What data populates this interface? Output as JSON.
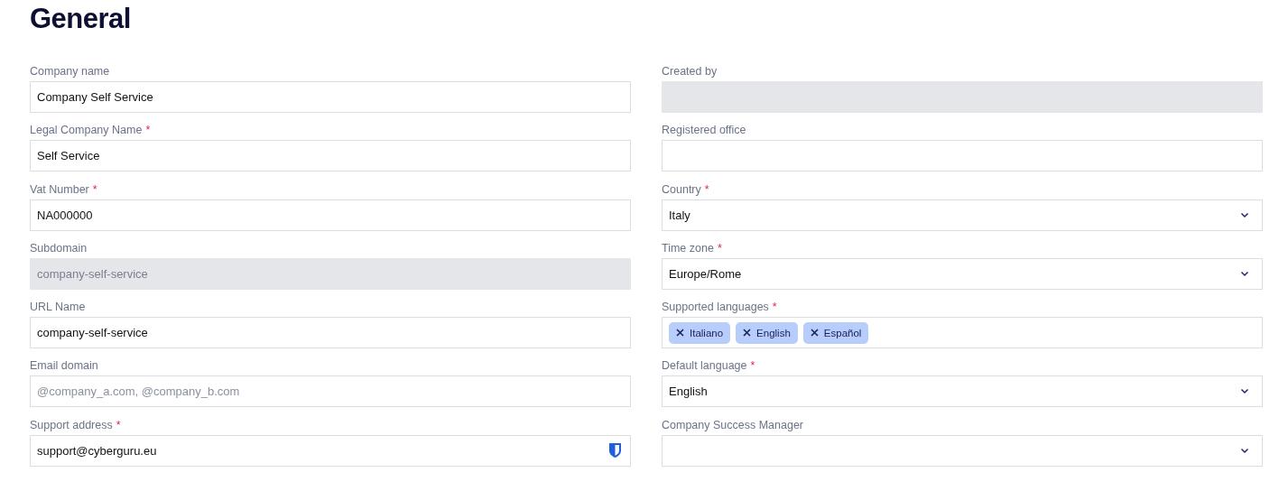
{
  "title": "General",
  "columns": [
    [
      {
        "label": "Company name",
        "kind": "text",
        "value": "Company Self Service"
      },
      {
        "label": "Legal Company Name",
        "asterisk": "*",
        "kind": "text",
        "value": "Self Service"
      },
      {
        "label": "Vat Number",
        "asterisk": "*",
        "kind": "text",
        "value": "NA000000"
      },
      {
        "label": "Subdomain",
        "kind": "text",
        "disabled": true,
        "value": "company-self-service"
      },
      {
        "label": "URL Name",
        "kind": "text",
        "value": "company-self-service"
      },
      {
        "label": "Email domain",
        "kind": "text",
        "placeholder": "@company_a.com, @company_b.com"
      },
      {
        "label": "Support address",
        "asterisk": "*",
        "kind": "text",
        "value": "support@cyberguru.eu",
        "shield": true
      }
    ],
    [
      {
        "label": "Created by",
        "kind": "text",
        "disabled": true
      },
      {
        "label": "Registered office",
        "kind": "text"
      },
      {
        "label": "Country",
        "asterisk": "*",
        "kind": "select",
        "value": "Italy"
      },
      {
        "label": "Time zone",
        "asterisk": "*",
        "kind": "select",
        "value": "Europe/Rome"
      },
      {
        "label": "Supported languages",
        "asterisk": "*",
        "kind": "tags",
        "tags": [
          "Italiano",
          "English",
          "Español"
        ]
      },
      {
        "label": "Default language",
        "asterisk": "*",
        "kind": "select",
        "value": "English"
      },
      {
        "label": "Company Success Manager",
        "kind": "select"
      }
    ]
  ]
}
